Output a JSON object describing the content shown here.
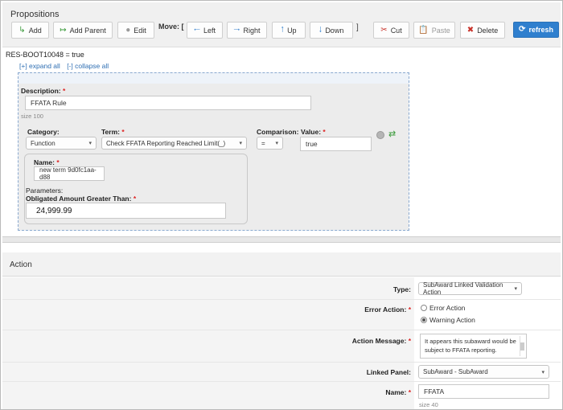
{
  "propositions": {
    "title": "Propositions",
    "toolbar": {
      "add": "Add",
      "add_parent": "Add Parent",
      "edit": "Edit",
      "move_label": "Move: [",
      "move_close": "]",
      "left": "Left",
      "right": "Right",
      "up": "Up",
      "down": "Down",
      "cut": "Cut",
      "paste": "Paste",
      "delete": "Delete",
      "refresh": "refresh"
    },
    "boot_text": "RES-BOOT10048 = true",
    "expand_all": "[+] expand all",
    "collapse_all": "[-] collapse all"
  },
  "rule": {
    "description_label": "Description:",
    "description_value": "FFATA Rule",
    "size_note": "size 100",
    "category_label": "Category:",
    "category_value": "Function",
    "term_label": "Term:",
    "term_value": "Check FFATA Reporting Reached Limit(_)",
    "comparison_label": "Comparison:",
    "comparison_value": "=",
    "value_label": "Value:",
    "value_value": "true",
    "name_label": "Name:",
    "name_value": "new term 9d0fc1aa-d88",
    "parameters_label": "Parameters:",
    "param_label": "Obligated Amount Greater Than:",
    "param_value": "24,999.99"
  },
  "action": {
    "title": "Action",
    "type_label": "Type:",
    "type_value": "SubAward Linked Validation Action",
    "error_action_label": "Error Action:",
    "error_option": "Error Action",
    "warning_option": "Warning Action",
    "selected_option": "Warning Action",
    "message_label": "Action Message:",
    "message_value": "It appears this subaward would be subject to FFATA reporting.",
    "linked_panel_label": "Linked Panel:",
    "linked_panel_value": "SubAward - SubAward",
    "name_label": "Name:",
    "name_value": "FFATA",
    "name_size_note": "size 40"
  },
  "colors": {
    "refresh_button": "#2f7fce",
    "link": "#2f6fb3",
    "required": "#dd2222",
    "delete_icon": "#c8322a",
    "arrow_icon": "#3a84cf"
  },
  "icons": {
    "add": "add-icon",
    "add_parent": "add-parent-icon",
    "edit": "edit-icon",
    "left": "arrow-left-icon",
    "right": "arrow-right-icon",
    "up": "arrow-up-icon",
    "down": "arrow-down-icon",
    "cut": "scissors-icon",
    "paste": "paste-icon",
    "delete": "x-icon",
    "refresh": "refresh-icon"
  }
}
